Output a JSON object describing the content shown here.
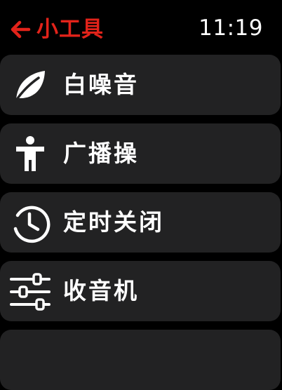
{
  "header": {
    "back_icon": "arrow-left-icon",
    "title": "小工具",
    "time": "11:19",
    "accent_color": "#e2231a"
  },
  "items": [
    {
      "label": "白噪音",
      "icon": "leaf-icon"
    },
    {
      "label": "广播操",
      "icon": "person-standing-icon"
    },
    {
      "label": "定时关闭",
      "icon": "clock-icon"
    },
    {
      "label": "收音机",
      "icon": "sliders-icon"
    }
  ],
  "colors": {
    "background": "#000000",
    "card": "#222223",
    "text": "#ffffff"
  }
}
